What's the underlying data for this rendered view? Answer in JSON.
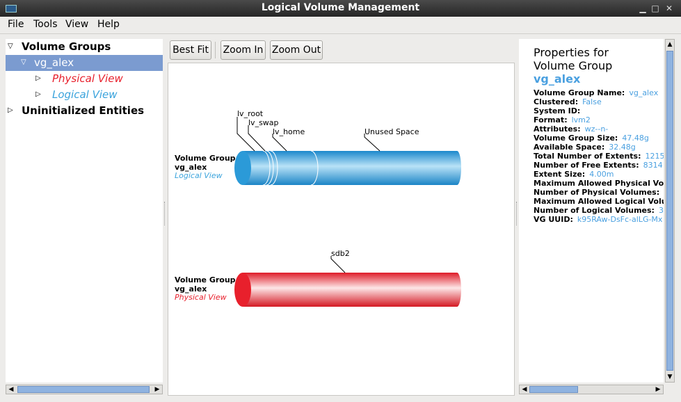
{
  "window": {
    "title": "Logical Volume Management"
  },
  "menu": [
    "File",
    "Tools",
    "View",
    "Help"
  ],
  "tree": {
    "volume_groups": "Volume Groups",
    "vg": "vg_alex",
    "physical_view": "Physical View",
    "logical_view": "Logical View",
    "uninitialized": "Uninitialized Entities"
  },
  "toolbar": {
    "best_fit": "Best Fit",
    "zoom_in": "Zoom In",
    "zoom_out": "Zoom Out"
  },
  "canvas": {
    "logical": {
      "line1": "Volume Group",
      "line2": "vg_alex",
      "line3": "Logical View",
      "labels": [
        "lv_root",
        "lv_swap",
        "lv_home",
        "Unused Space"
      ]
    },
    "physical": {
      "line1": "Volume Group",
      "line2": "vg_alex",
      "line3": "Physical View",
      "labels": [
        "sdb2"
      ]
    },
    "colors": {
      "logical": "#2b9ad8",
      "physical": "#e8202c"
    }
  },
  "properties": {
    "heading1": "Properties for",
    "heading2": "Volume Group",
    "name": "vg_alex",
    "rows": [
      {
        "label": "Volume Group Name:",
        "value": "vg_alex"
      },
      {
        "label": "Clustered:",
        "value": "False"
      },
      {
        "label": "System ID:",
        "value": ""
      },
      {
        "label": "Format:",
        "value": "lvm2"
      },
      {
        "label": "Attributes:",
        "value": "wz--n-"
      },
      {
        "label": "Volume Group Size:",
        "value": "47.48g"
      },
      {
        "label": "Available Space:",
        "value": "32.48g"
      },
      {
        "label": "Total Number of Extents:",
        "value": "1215"
      },
      {
        "label": "Number of Free Extents:",
        "value": "8314"
      },
      {
        "label": "Extent Size:",
        "value": "4.00m"
      },
      {
        "label": "Maximum Allowed Physical Volu",
        "value": ""
      },
      {
        "label": "Number of Physical Volumes:",
        "value": ""
      },
      {
        "label": "Maximum Allowed Logical Volu",
        "value": ""
      },
      {
        "label": "Number of Logical Volumes:",
        "value": "3"
      },
      {
        "label": "VG UUID:",
        "value": "k95RAw-DsFc-alLG-Mx"
      }
    ]
  }
}
